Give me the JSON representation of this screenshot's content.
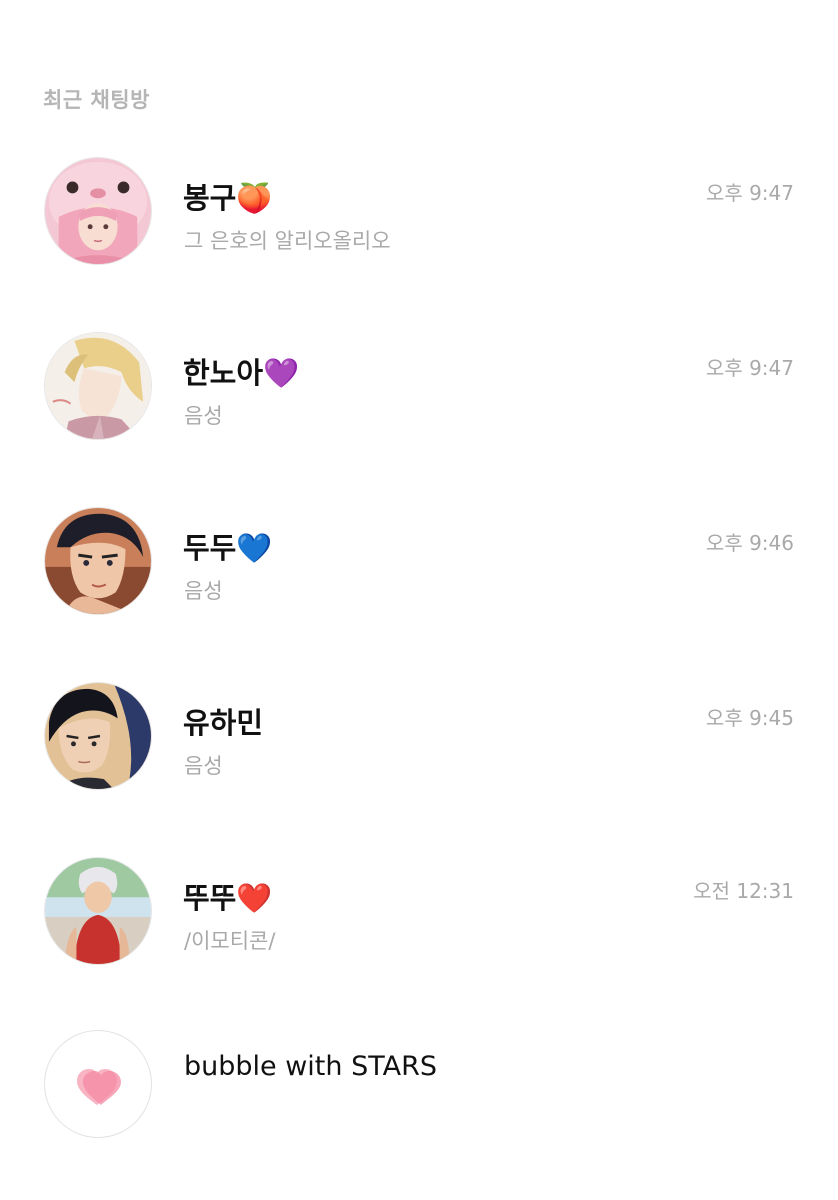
{
  "section_title": "최근 채팅방",
  "chats": [
    {
      "name": "봉구🍑",
      "preview": "그 은호의 알리오올리오",
      "time": "오후 9:47",
      "avatar_icon": "pink-hat-anime-avatar"
    },
    {
      "name": "한노아💜",
      "preview": "음성",
      "time": "오후 9:47",
      "avatar_icon": "blonde-anime-avatar"
    },
    {
      "name": "두두💙",
      "preview": "음성",
      "time": "오후 9:46",
      "avatar_icon": "dark-hair-anime-avatar"
    },
    {
      "name": "유하민",
      "preview": "음성",
      "time": "오후 9:45",
      "avatar_icon": "black-hair-anime-avatar"
    },
    {
      "name": "뚜뚜❤️",
      "preview": "/이모티콘/",
      "time": "오전 12:31",
      "avatar_icon": "silver-hair-anime-avatar"
    }
  ],
  "bubble": {
    "label": "bubble with STARS",
    "icon": "pink-heart-icon",
    "heart_colors": [
      "#f7a7b8",
      "#f48aa2"
    ]
  }
}
